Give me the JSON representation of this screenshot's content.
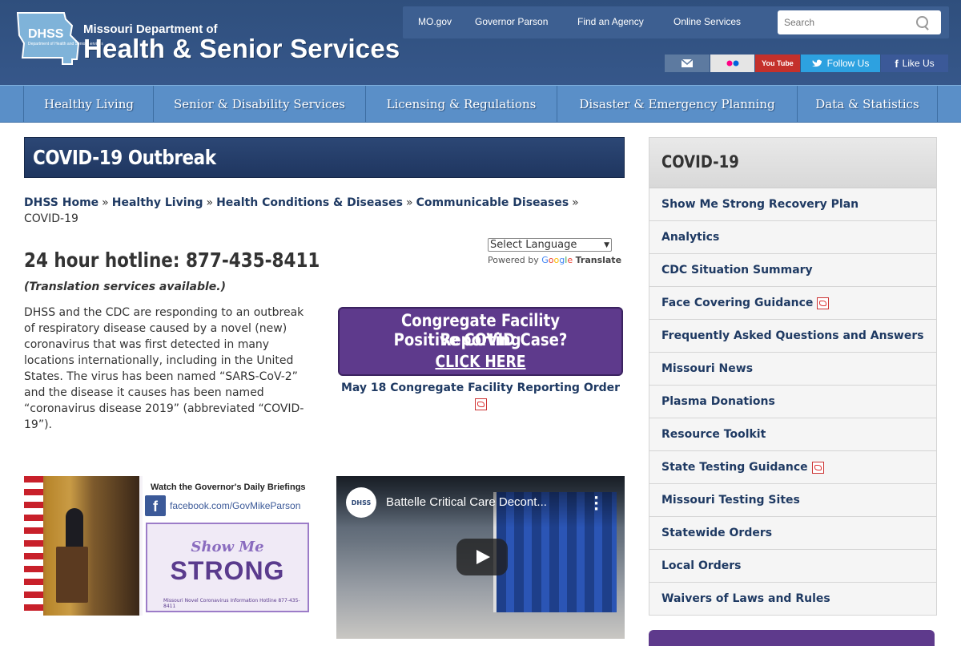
{
  "header": {
    "logo_abbr": "DHSS",
    "logo_abbr_sub": "Department of Health and Senior Services",
    "logo_top": "Missouri Department of",
    "logo_main": "Health & Senior Services"
  },
  "toplinks": [
    "MO.gov",
    "Governor Parson",
    "Find an Agency",
    "Online Services"
  ],
  "search": {
    "placeholder": "Search"
  },
  "social": {
    "flickr": "●●",
    "youtube": "You Tube",
    "twitter": "Follow Us",
    "facebook": "Like Us"
  },
  "nav": [
    "Healthy Living",
    "Senior & Disability Services",
    "Licensing & Regulations",
    "Disaster & Emergency Planning",
    "Data & Statistics"
  ],
  "page": {
    "title": "COVID-19 Outbreak",
    "breadcrumbs": [
      "DHSS Home",
      "Healthy Living",
      "Health Conditions & Diseases",
      "Communicable Diseases"
    ],
    "breadcrumb_current": "COVID-19",
    "hotline": "24 hour hotline: 877-435-8411",
    "translation_note": "(Translation services available.)",
    "paragraph": "DHSS and the CDC are responding to an outbreak of respiratory disease caused by a novel (new) coronavirus that was first detected in many locations internationally, including in the United States. The virus has been named “SARS-CoV-2” and the disease it causes has been named “coronavirus disease 2019” (abbreviated “COVID-19”)."
  },
  "translate": {
    "select_label": "Select Language",
    "powered_by": "Powered by",
    "google": [
      "G",
      "o",
      "o",
      "g",
      "l",
      "e"
    ],
    "translate_word": "Translate"
  },
  "banner": {
    "line1": "Congregate Facility Reporting",
    "line2": "Positive COVID Case?",
    "line3": "CLICK HERE",
    "order_link": "May 18 Congregate Facility Reporting Order"
  },
  "gov_graphic": {
    "watch": "Watch the Governor's Daily Briefings",
    "fb_url": "facebook.com/GovMikeParson",
    "show_me": "Show Me",
    "strong": "STRONG",
    "hotline_small": "Missouri Novel Coronavirus Information Hotline 877-435-8411"
  },
  "video": {
    "title": "Battelle Critical Care Decont...",
    "channel": "DHSS"
  },
  "sidebar": {
    "heading": "COVID-19",
    "items": [
      {
        "label": "Show Me Strong Recovery Plan",
        "pdf": false
      },
      {
        "label": "Analytics",
        "pdf": false
      },
      {
        "label": "CDC Situation Summary",
        "pdf": false
      },
      {
        "label": "Face Covering Guidance",
        "pdf": true
      },
      {
        "label": "Frequently Asked Questions and Answers",
        "pdf": false
      },
      {
        "label": "Missouri News",
        "pdf": false
      },
      {
        "label": "Plasma Donations",
        "pdf": false
      },
      {
        "label": "Resource Toolkit",
        "pdf": false
      },
      {
        "label": "State Testing Guidance",
        "pdf": true
      },
      {
        "label": "Missouri Testing Sites",
        "pdf": false
      },
      {
        "label": "Statewide Orders",
        "pdf": false
      },
      {
        "label": "Local Orders",
        "pdf": false
      },
      {
        "label": "Waivers of Laws and Rules",
        "pdf": false
      }
    ]
  },
  "colors": {
    "header": "#36578a",
    "nav": "#5a8fc8",
    "title_bar": "#2c4775",
    "banner": "#5e3a8c",
    "link": "#1f3a63"
  }
}
